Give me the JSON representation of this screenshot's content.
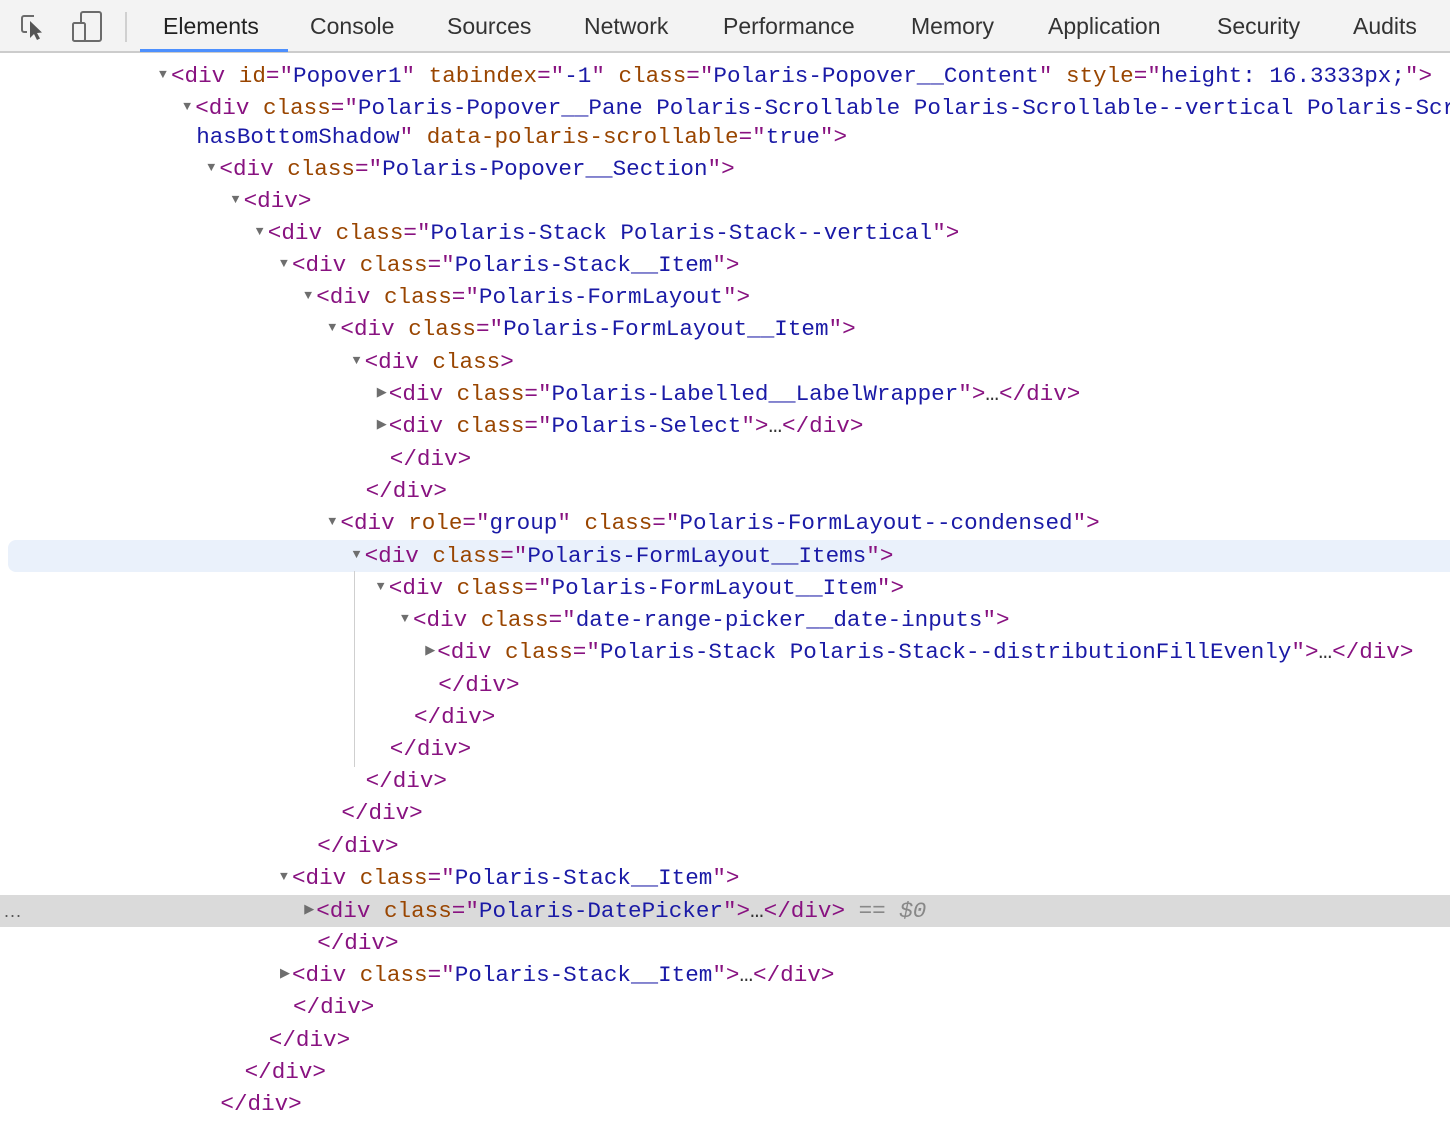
{
  "toolbar": {
    "icons": [
      {
        "name": "inspect-element-icon",
        "glyph": "inspect"
      },
      {
        "name": "device-toolbar-icon",
        "glyph": "device"
      }
    ],
    "tabs": [
      {
        "label": "Elements",
        "active": true
      },
      {
        "label": "Console"
      },
      {
        "label": "Sources"
      },
      {
        "label": "Network"
      },
      {
        "label": "Performance"
      },
      {
        "label": "Memory"
      },
      {
        "label": "Application"
      },
      {
        "label": "Security"
      },
      {
        "label": "Audits"
      }
    ],
    "accent_color": "#4d90fe"
  },
  "colors": {
    "tag": "#881280",
    "attr_name": "#994500",
    "attr_value": "#1a1aa6",
    "hover_row": "#eaf1fb",
    "selected_row": "#dadada"
  },
  "dom_tree": [
    {
      "depth": 0,
      "toggle": "open",
      "open": "div",
      "attrs": [
        [
          "id",
          "Popover1"
        ],
        [
          "tabindex",
          "-1"
        ],
        [
          "class",
          "Polaris-Popover__Content"
        ],
        [
          "style",
          "height: 16.3333px;"
        ]
      ]
    },
    {
      "depth": 1,
      "toggle": "open",
      "open": "div",
      "attrs": [
        [
          "class",
          "Polaris-Popover__Pane Polaris-Scrollable Polaris-Scrollable--vertical Polaris-Scro"
        ]
      ],
      "truncated": true
    },
    {
      "depth": 1,
      "continuation": true,
      "segments": [
        [
          "attr-val",
          "hasBottomShadow"
        ],
        [
          "q",
          "\""
        ],
        [
          "plain",
          " "
        ],
        [
          "attr-name",
          "data-polaris-scrollable"
        ],
        [
          "eq",
          "="
        ],
        [
          "q",
          "\""
        ],
        [
          "attr-val",
          "true"
        ],
        [
          "q",
          "\""
        ],
        [
          "tag",
          ">"
        ]
      ]
    },
    {
      "depth": 2,
      "toggle": "open",
      "open": "div",
      "attrs": [
        [
          "class",
          "Polaris-Popover__Section"
        ]
      ]
    },
    {
      "depth": 3,
      "toggle": "open",
      "open": "div",
      "attrs": []
    },
    {
      "depth": 4,
      "toggle": "open",
      "open": "div",
      "attrs": [
        [
          "class",
          "Polaris-Stack Polaris-Stack--vertical"
        ]
      ]
    },
    {
      "depth": 5,
      "toggle": "open",
      "open": "div",
      "attrs": [
        [
          "class",
          "Polaris-Stack__Item"
        ]
      ]
    },
    {
      "depth": 6,
      "toggle": "open",
      "open": "div",
      "attrs": [
        [
          "class",
          "Polaris-FormLayout"
        ]
      ]
    },
    {
      "depth": 7,
      "toggle": "open",
      "open": "div",
      "attrs": [
        [
          "class",
          "Polaris-FormLayout__Item"
        ]
      ]
    },
    {
      "depth": 8,
      "toggle": "open",
      "open": "div",
      "attrs": [
        [
          "class",
          null
        ]
      ]
    },
    {
      "depth": 9,
      "toggle": "closed",
      "open": "div",
      "attrs": [
        [
          "class",
          "Polaris-Labelled__LabelWrapper"
        ]
      ],
      "collapsed": true
    },
    {
      "depth": 9,
      "toggle": "closed",
      "open": "div",
      "attrs": [
        [
          "class",
          "Polaris-Select"
        ]
      ],
      "collapsed": true
    },
    {
      "depth": 9,
      "close": "div"
    },
    {
      "depth": 8,
      "close": "div"
    },
    {
      "depth": 7,
      "toggle": "open",
      "open": "div",
      "attrs": [
        [
          "role",
          "group"
        ],
        [
          "class",
          "Polaris-FormLayout--condensed"
        ]
      ]
    },
    {
      "depth": 8,
      "toggle": "open",
      "open": "div",
      "attrs": [
        [
          "class",
          "Polaris-FormLayout__Items"
        ]
      ],
      "state": "hover"
    },
    {
      "depth": 9,
      "toggle": "open",
      "open": "div",
      "attrs": [
        [
          "class",
          "Polaris-FormLayout__Item"
        ]
      ]
    },
    {
      "depth": 10,
      "toggle": "open",
      "open": "div",
      "attrs": [
        [
          "class",
          "date-range-picker__date-inputs"
        ]
      ]
    },
    {
      "depth": 11,
      "toggle": "closed",
      "open": "div",
      "attrs": [
        [
          "class",
          "Polaris-Stack Polaris-Stack--distributionFillEvenly"
        ]
      ],
      "collapsed": true
    },
    {
      "depth": 11,
      "close": "div"
    },
    {
      "depth": 10,
      "close": "div"
    },
    {
      "depth": 9,
      "close": "div"
    },
    {
      "depth": 8,
      "close": "div"
    },
    {
      "depth": 7,
      "close": "div"
    },
    {
      "depth": 6,
      "close": "div"
    },
    {
      "depth": 5,
      "toggle": "open",
      "open": "div",
      "attrs": [
        [
          "class",
          "Polaris-Stack__Item"
        ]
      ]
    },
    {
      "depth": 6,
      "toggle": "closed",
      "open": "div",
      "attrs": [
        [
          "class",
          "Polaris-DatePicker"
        ]
      ],
      "collapsed": true,
      "state": "selected",
      "suffix": " == $0"
    },
    {
      "depth": 6,
      "close": "div"
    },
    {
      "depth": 5,
      "toggle": "closed",
      "open": "div",
      "attrs": [
        [
          "class",
          "Polaris-Stack__Item"
        ]
      ],
      "collapsed": true
    },
    {
      "depth": 5,
      "close": "div"
    },
    {
      "depth": 4,
      "close": "div"
    },
    {
      "depth": 3,
      "close": "div"
    },
    {
      "depth": 2,
      "close": "div"
    }
  ],
  "selected_row_gutter": "..."
}
